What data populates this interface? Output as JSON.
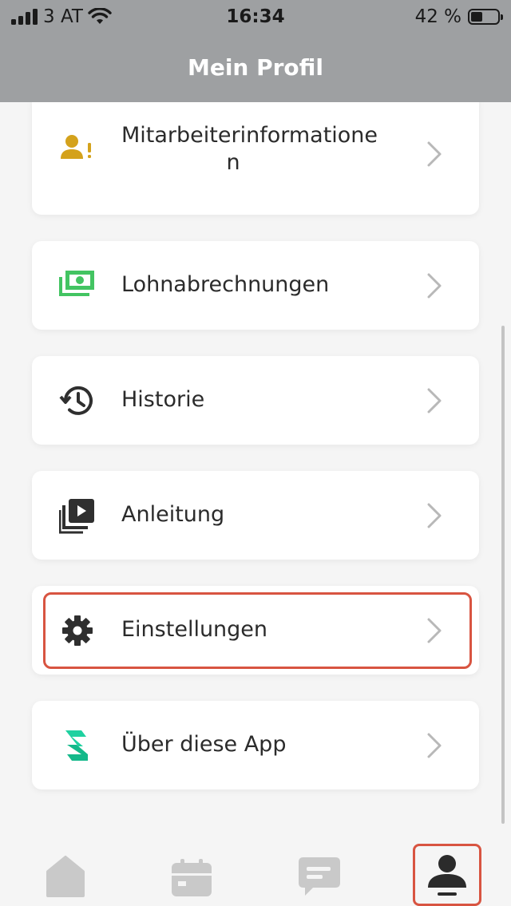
{
  "status_bar": {
    "carrier": "3 AT",
    "time": "16:34",
    "battery": "42 %",
    "battery_level": 0.42
  },
  "header": {
    "title": "Mein Profil"
  },
  "menu": [
    {
      "label_line1": "Mitarbeiterinformatione",
      "label_line2": "n",
      "icon": "employee-info-icon"
    },
    {
      "label": "Lohnabrechnungen",
      "icon": "payslip-money-icon"
    },
    {
      "label": "Historie",
      "icon": "history-icon"
    },
    {
      "label": "Anleitung",
      "icon": "video-tutorial-icon"
    },
    {
      "label": "Einstellungen",
      "icon": "gear-icon"
    },
    {
      "label": "Über diese App",
      "icon": "app-logo-icon"
    }
  ],
  "tabs": [
    {
      "name": "home-icon"
    },
    {
      "name": "calendar-icon"
    },
    {
      "name": "chat-icon"
    },
    {
      "name": "profile-icon",
      "active": true
    }
  ],
  "colors": {
    "header_bg": "#9ea0a2",
    "highlight": "#d85441",
    "icon_gold": "#d4a21c",
    "icon_green": "#43c462",
    "icon_teal": "#1fd1a0",
    "icon_dark": "#2f2f2f",
    "tab_inactive": "#c9c9c9"
  }
}
